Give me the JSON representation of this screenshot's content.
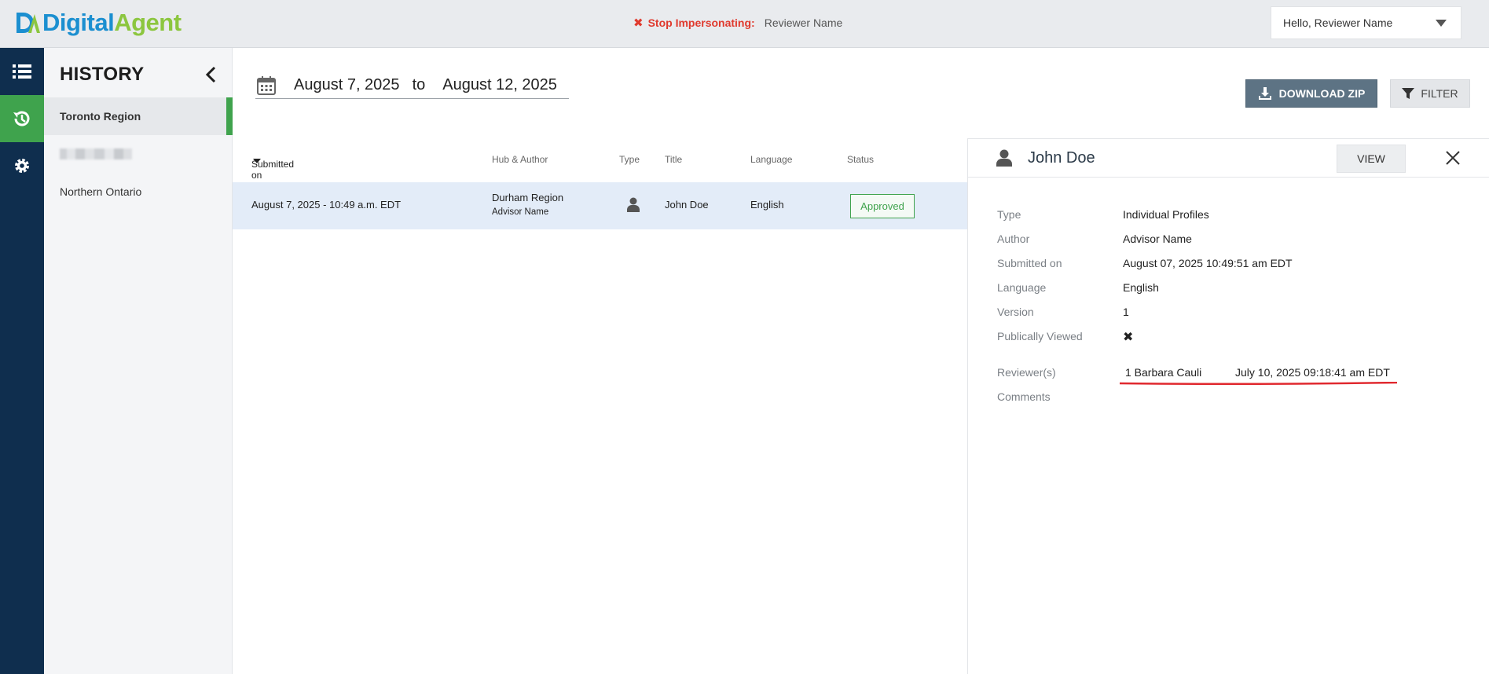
{
  "brand": {
    "part1": "Digital",
    "part2": "Agent",
    "primary_color": "#1b8fd0",
    "secondary_color": "#8cc63f"
  },
  "impersonation": {
    "stop_label": "Stop Impersonating:",
    "name": "Reviewer Name"
  },
  "user_menu": {
    "greeting": "Hello,  Reviewer Name"
  },
  "rail": {
    "items": [
      {
        "icon": "list-icon"
      },
      {
        "icon": "history-icon",
        "active": true
      },
      {
        "icon": "gear-icon"
      }
    ],
    "active_color": "#3fa34d",
    "bg_color": "#0f2e4e"
  },
  "sidebar": {
    "title": "HISTORY",
    "items": [
      {
        "label": "Toronto Region",
        "active": true
      },
      {
        "label": ""
      },
      {
        "label": "Northern Ontario"
      }
    ]
  },
  "date_range": {
    "from": "August 7, 2025",
    "separator": "to",
    "to": "August 12, 2025"
  },
  "toolbar": {
    "download_label": "DOWNLOAD ZIP",
    "filter_label": "FILTER"
  },
  "table": {
    "headers": {
      "submitted": "Submitted on",
      "hub": "Hub & Author",
      "type": "Type",
      "title": "Title",
      "language": "Language",
      "status": "Status"
    },
    "rows": [
      {
        "submitted": "August 7, 2025 - 10:49 a.m. EDT",
        "hub": "Durham Region",
        "author": "Advisor Name",
        "type_icon": "person-icon",
        "title": "John Doe",
        "language": "English",
        "status": "Approved"
      }
    ]
  },
  "detail": {
    "name": "John Doe",
    "view_label": "VIEW",
    "fields": {
      "type_k": "Type",
      "type_v": "Individual Profiles",
      "author_k": "Author",
      "author_v": "Advisor Name",
      "submitted_k": "Submitted on",
      "submitted_v": "August 07, 2025 10:49:51 am EDT",
      "language_k": "Language",
      "language_v": "English",
      "version_k": "Version",
      "version_v": "1",
      "public_k": "Publically Viewed",
      "public_v": "✖",
      "reviewers_k": "Reviewer(s)",
      "reviewer_name": "1 Barbara Cauli",
      "reviewer_date": "July 10, 2025 09:18:41 am EDT",
      "comments_k": "Comments"
    }
  }
}
